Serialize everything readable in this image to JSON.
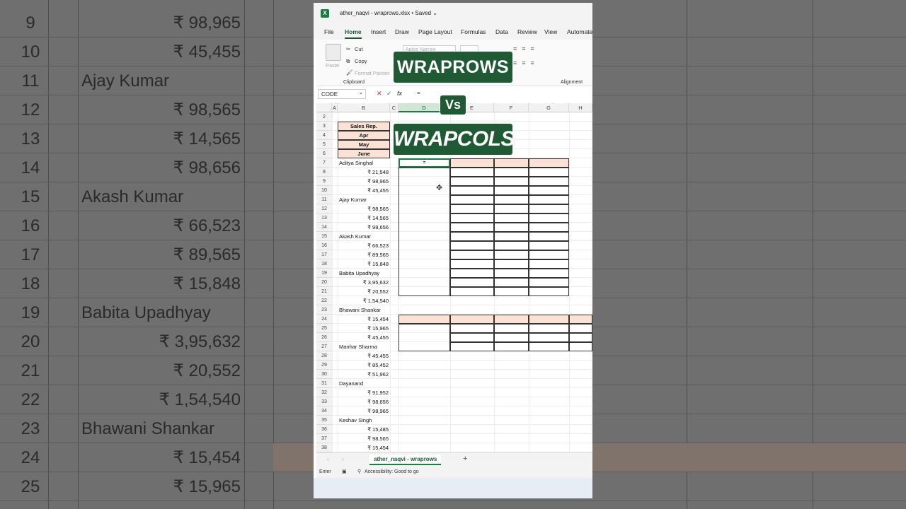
{
  "background": {
    "rows": [
      {
        "num": "9",
        "value": "₹ 98,965",
        "numeric": true
      },
      {
        "num": "10",
        "value": "₹ 45,455",
        "numeric": true
      },
      {
        "num": "11",
        "value": "Ajay Kumar",
        "numeric": false
      },
      {
        "num": "12",
        "value": "₹ 98,565",
        "numeric": true
      },
      {
        "num": "13",
        "value": "₹ 14,565",
        "numeric": true
      },
      {
        "num": "14",
        "value": "₹ 98,656",
        "numeric": true
      },
      {
        "num": "15",
        "value": "Akash Kumar",
        "numeric": false
      },
      {
        "num": "16",
        "value": "₹ 66,523",
        "numeric": true
      },
      {
        "num": "17",
        "value": "₹ 89,565",
        "numeric": true
      },
      {
        "num": "18",
        "value": "₹ 15,848",
        "numeric": true
      },
      {
        "num": "19",
        "value": "Babita Upadhyay",
        "numeric": false
      },
      {
        "num": "20",
        "value": "₹ 3,95,632",
        "numeric": true
      },
      {
        "num": "21",
        "value": "₹ 20,552",
        "numeric": true
      },
      {
        "num": "22",
        "value": "₹ 1,54,540",
        "numeric": true
      },
      {
        "num": "23",
        "value": "Bhawani Shankar",
        "numeric": false
      },
      {
        "num": "24",
        "value": "₹ 15,454",
        "numeric": true
      },
      {
        "num": "25",
        "value": "₹ 15,965",
        "numeric": true
      }
    ]
  },
  "titlebar": {
    "app_icon": "X",
    "title": "ather_naqvi - wraprows.xlsx • Saved ⌄"
  },
  "menu": [
    "File",
    "Home",
    "Insert",
    "Draw",
    "Page Layout",
    "Formulas",
    "Data",
    "Review",
    "View",
    "Automate"
  ],
  "ribbon": {
    "paste": "Paste",
    "cut": "Cut",
    "copy": "Copy",
    "format_painter": "Format Painter",
    "clipboard_group": "Clipboard",
    "font_name": "Aptos Narrow",
    "alignment_group": "Alignment"
  },
  "formula_bar": {
    "name_box": "CODE",
    "fx": "fx",
    "formula": "="
  },
  "columns": [
    "A",
    "B",
    "C",
    "D",
    "E",
    "F",
    "G",
    "H"
  ],
  "row_numbers": [
    "2",
    "3",
    "4",
    "5",
    "6",
    "7",
    "8",
    "9",
    "10",
    "11",
    "12",
    "13",
    "14",
    "15",
    "16",
    "17",
    "18",
    "19",
    "20",
    "21",
    "22",
    "23",
    "24",
    "25",
    "26",
    "27",
    "28",
    "29",
    "30",
    "31",
    "32",
    "33",
    "34",
    "35",
    "36",
    "37",
    "38"
  ],
  "headers": [
    "Sales Rep.",
    "Apr",
    "May",
    "June"
  ],
  "column_b": [
    {
      "v": "Aditya Singhal",
      "n": false
    },
    {
      "v": "₹ 21,548",
      "n": true
    },
    {
      "v": "₹ 98,965",
      "n": true
    },
    {
      "v": "₹ 45,455",
      "n": true
    },
    {
      "v": "Ajay Kumar",
      "n": false
    },
    {
      "v": "₹ 98,565",
      "n": true
    },
    {
      "v": "₹ 14,565",
      "n": true
    },
    {
      "v": "₹ 98,656",
      "n": true
    },
    {
      "v": "Akash Kumar",
      "n": false
    },
    {
      "v": "₹ 66,523",
      "n": true
    },
    {
      "v": "₹ 89,565",
      "n": true
    },
    {
      "v": "₹ 15,848",
      "n": true
    },
    {
      "v": "Babita Upadhyay",
      "n": false
    },
    {
      "v": "₹ 3,95,632",
      "n": true
    },
    {
      "v": "₹ 20,552",
      "n": true
    },
    {
      "v": "₹ 1,54,540",
      "n": true
    },
    {
      "v": "Bhawani Shankar",
      "n": false
    },
    {
      "v": "₹ 15,454",
      "n": true
    },
    {
      "v": "₹ 15,965",
      "n": true
    },
    {
      "v": "₹ 45,455",
      "n": true
    },
    {
      "v": "Manhar Sharma",
      "n": false
    },
    {
      "v": "₹ 45,455",
      "n": true
    },
    {
      "v": "₹ 85,452",
      "n": true
    },
    {
      "v": "₹ 51,962",
      "n": true
    },
    {
      "v": "Dayanand",
      "n": false
    },
    {
      "v": "₹ 91,952",
      "n": true
    },
    {
      "v": "₹ 98,656",
      "n": true
    },
    {
      "v": "₹ 98,965",
      "n": true
    },
    {
      "v": "Keshav Singh",
      "n": false
    },
    {
      "v": "₹ 15,485",
      "n": true
    },
    {
      "v": "₹ 98,565",
      "n": true
    },
    {
      "v": "₹ 15,454",
      "n": true
    }
  ],
  "active_cell_value": "=",
  "sheet_tab": "ather_naqvi - wraprows",
  "add_sheet": "+",
  "status": {
    "mode": "Enter",
    "accessibility": "Accessibility: Good to go"
  },
  "overlay": {
    "title1": "WRAPROWS",
    "vs": "Vs",
    "title2": "WRAPCOLS"
  },
  "colors": {
    "accent": "#1e7a45",
    "header_fill": "#fbe2d5",
    "badge": "#1f5a34"
  }
}
